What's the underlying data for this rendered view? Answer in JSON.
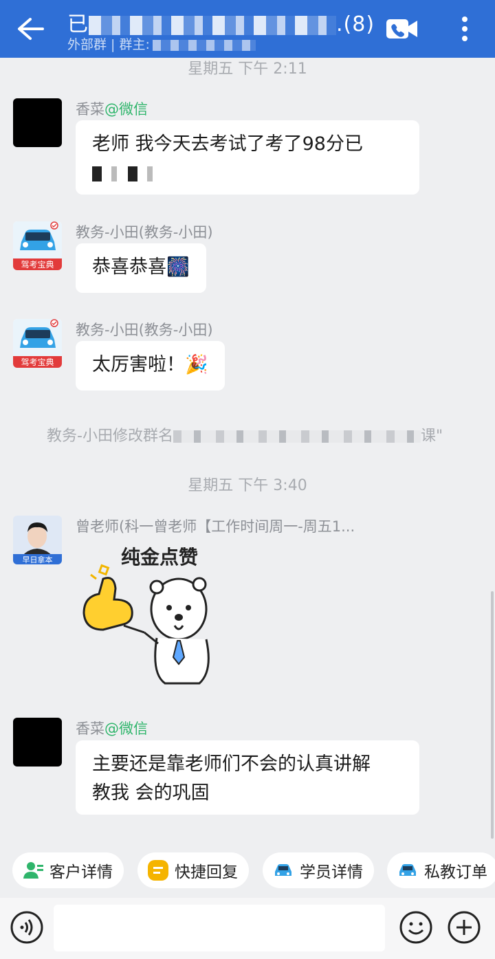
{
  "header": {
    "title_prefix": "已",
    "title_suffix": ".(8)",
    "subtitle": "外部群 | 群主:"
  },
  "messages": {
    "time1": "星期五 下午 2:11",
    "m1_sender": "香菜",
    "m1_tag": "@微信",
    "m1_text_a": "老师 我今天去考试了考了98分已",
    "m2_sender": "教务-小田(教务-小田)",
    "m2_text": "恭喜恭喜🎆",
    "m3_sender": "教务-小田(教务-小田)",
    "m3_text": "太厉害啦！🎉",
    "sys_prefix": "教务-小田修改群名",
    "sys_suffix": "课\"",
    "time2": "星期五 下午 3:40",
    "m4_sender": "曾老师(科一曾老师【工作时间周一-周五1...",
    "sticker_text": "纯金点赞",
    "m5_sender": "香菜",
    "m5_tag": "@微信",
    "m5_line1": "主要还是靠老师们不会的认真讲解",
    "m5_line2": "教我  会的巩固"
  },
  "avatars": {
    "app_label": "驾考宝典",
    "teacher_label": "早日拿本"
  },
  "quick_actions": [
    {
      "label": "客户详情",
      "icon": "customer-icon"
    },
    {
      "label": "快捷回复",
      "icon": "quick-reply-icon"
    },
    {
      "label": "学员详情",
      "icon": "car-icon"
    },
    {
      "label": "私教订单",
      "icon": "car-icon"
    }
  ],
  "colors": {
    "header": "#2f6fd6",
    "wechat_green": "#2fb56b",
    "background": "#eeeff1"
  }
}
